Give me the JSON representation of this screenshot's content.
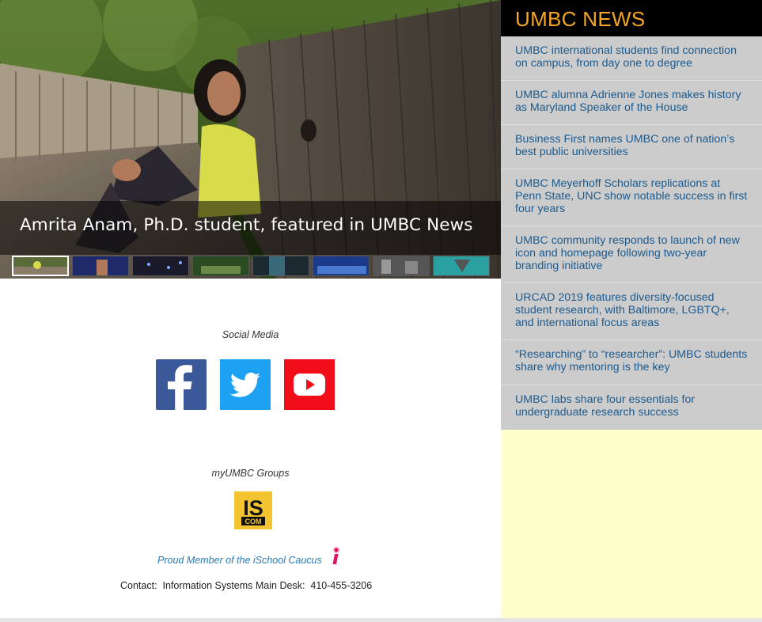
{
  "hero": {
    "caption": "Amrita Anam, Ph.D. student, featured in UMBC News",
    "thumbnails": [
      {
        "name": "thumb-1",
        "active": true
      },
      {
        "name": "thumb-2",
        "active": false
      },
      {
        "name": "thumb-3",
        "active": false
      },
      {
        "name": "thumb-4",
        "active": false
      },
      {
        "name": "thumb-5",
        "active": false
      },
      {
        "name": "thumb-6",
        "active": false
      },
      {
        "name": "thumb-7",
        "active": false
      },
      {
        "name": "thumb-8",
        "active": false
      }
    ]
  },
  "news": {
    "title": "UMBC NEWS",
    "items": [
      "UMBC international students find connection on campus, from day one to degree",
      "UMBC alumna Adrienne Jones makes history as Maryland Speaker of the House",
      "Business First names UMBC one of nation’s best public universities",
      "UMBC Meyerhoff Scholars replications at Penn State, UNC show notable success in first four years",
      "UMBC community responds to launch of new icon and homepage following two-year branding initiative",
      "URCAD 2019 features diversity-focused student research, with Baltimore, LGBTQ+, and international focus areas",
      "“Researching” to “researcher”: UMBC students share why mentoring is the key",
      "UMBC labs share four essentials for undergraduate research success"
    ]
  },
  "social": {
    "label": "Social Media",
    "icons": [
      "facebook-icon",
      "twitter-icon",
      "youtube-icon"
    ]
  },
  "groups": {
    "label": "myUMBC Groups",
    "logo_text_top": "IS",
    "logo_text_bottom": "COM"
  },
  "caucus": {
    "text": "Proud Member of the iSchool Caucus"
  },
  "contact": {
    "text": "Contact:  Information Systems Main Desk:  410-455-3206"
  },
  "colors": {
    "news_title": "#f5a623",
    "news_link": "#1c5a8e",
    "facebook": "#3b5998",
    "twitter": "#1da1f2",
    "youtube": "#ff0000",
    "sidebar_fill": "#ffffcc"
  }
}
